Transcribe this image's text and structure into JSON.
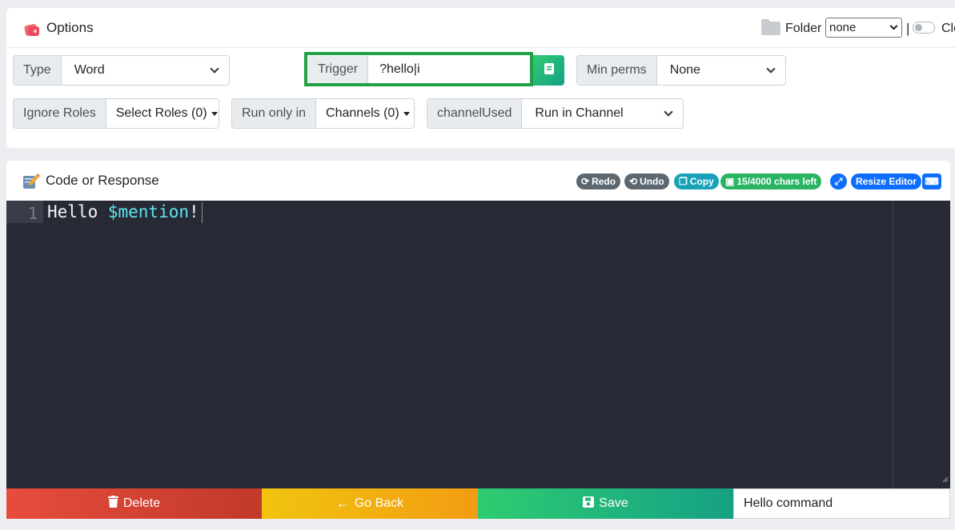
{
  "options": {
    "title": "Options",
    "folder_label": "Folder",
    "folder_value": "none",
    "separator": "|",
    "toggle_label": "Clo",
    "type": {
      "label": "Type",
      "value": "Word"
    },
    "trigger": {
      "label": "Trigger",
      "value": "?hello|i"
    },
    "min_perms": {
      "label": "Min perms",
      "value": "None"
    },
    "ignore_roles": {
      "label": "Ignore Roles",
      "value": "Select Roles (0)"
    },
    "run_only_in": {
      "label": "Run only in",
      "value": "Channels (0)"
    },
    "channel_used": {
      "label": "channelUsed",
      "value": "Run in Channel"
    }
  },
  "code": {
    "title": "Code or Response",
    "toolbar": {
      "redo": "Redo",
      "undo": "Undo",
      "copy": "Copy",
      "chars_left": "15/4000 chars left",
      "resize": "Resize Editor"
    },
    "line_number": "1",
    "line_text": "Hello ",
    "line_var": "$mention",
    "line_end": "!"
  },
  "footer": {
    "delete": "Delete",
    "go_back": "Go Back",
    "save": "Save",
    "name_value": "Hello command"
  },
  "colors": {
    "trigger_highlight": "#22a045",
    "editor_bg": "#272a35",
    "delete_start": "#e74c3c",
    "goback_start": "#f1c40f",
    "save_start": "#2ecc71"
  }
}
